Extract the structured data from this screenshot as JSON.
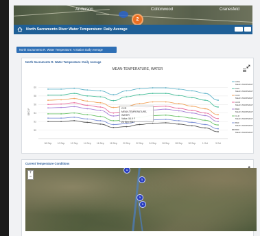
{
  "map_top": {
    "labels": [
      "Anderson",
      "Cottonwood",
      "Cranesfeld"
    ],
    "cluster_count": "2"
  },
  "header": {
    "title": "North Sacramento River Water Temperature: Daily Average",
    "control_a": "",
    "control_b": ""
  },
  "station_button": "North Sacramento R. Water Temperature: A Station Daily Average",
  "chart_panel": {
    "title": "North Sacramento R. Water Temperature: Daily Average",
    "tooltip": {
      "line1": "CCR",
      "line2": "MEAN-TEMPERATURE, WATER",
      "line3": "Value: 54.9 F",
      "line4": "24 Sep 2017"
    }
  },
  "chart_data": {
    "type": "line",
    "title": "MEAN-TEMPERATURE, WATER",
    "ylabel": "DEG F",
    "categories": [
      "06 Sep",
      "10 Sep",
      "12 Sep",
      "14 Sep",
      "16 Sep",
      "18 Sep",
      "20 Sep",
      "22 Sep",
      "24 Sep",
      "26 Sep",
      "28 Sep",
      "30 Sep",
      "1 Oct",
      "3 Oct"
    ],
    "ylim": [
      48,
      62
    ],
    "yticks": [
      50,
      52,
      54,
      56,
      58,
      60
    ],
    "series": [
      {
        "name": "CWA MEAN-TEMPERATURE, WATER",
        "color": "#5fb3c9",
        "values": [
          59.6,
          59.6,
          59.8,
          59.4,
          59.2,
          58.3,
          59.2,
          59.7,
          59.9,
          59.9,
          59.6,
          59.2,
          58.6,
          57.0
        ]
      },
      {
        "name": "KES MEAN-TEMPERATURE, WATER",
        "color": "#4bbf9c",
        "values": [
          58.2,
          58.2,
          58.6,
          58.0,
          57.8,
          56.9,
          57.8,
          58.3,
          58.6,
          58.6,
          58.1,
          57.6,
          57.0,
          55.4
        ]
      },
      {
        "name": "CCR MEAN-TEMPERATURE, WATER",
        "color": "#f0a15a",
        "values": [
          57.0,
          57.1,
          57.4,
          56.8,
          56.4,
          55.3,
          55.6,
          56.2,
          56.6,
          56.6,
          56.2,
          55.6,
          55.0,
          53.6
        ]
      },
      {
        "name": "ACID MEAN-TEMPERATURE, WATER",
        "color": "#e86a9a",
        "values": [
          56.0,
          56.1,
          56.4,
          55.8,
          55.4,
          54.0,
          54.4,
          55.1,
          55.5,
          55.6,
          55.1,
          54.6,
          54.0,
          52.7
        ]
      },
      {
        "name": "BND MEAN-TEMPERATURE, WATER",
        "color": "#a77fd6",
        "values": [
          55.2,
          55.3,
          55.5,
          55.0,
          54.6,
          53.3,
          53.7,
          54.3,
          54.7,
          54.9,
          54.5,
          54.0,
          53.4,
          52.0
        ]
      },
      {
        "name": "CLR MEAN-TEMPERATURE, WATER",
        "color": "#6cc36a",
        "values": [
          53.8,
          53.8,
          54.0,
          53.6,
          53.2,
          52.2,
          52.4,
          53.0,
          53.4,
          53.5,
          53.2,
          52.8,
          52.3,
          51.2
        ]
      },
      {
        "name": "BSF MEAN-TEMPERATURE, WATER",
        "color": "#7b8fd6",
        "values": [
          52.8,
          52.8,
          53.0,
          52.6,
          52.2,
          51.3,
          51.5,
          52.1,
          52.4,
          52.5,
          52.2,
          51.8,
          51.3,
          50.3
        ]
      },
      {
        "name": "BDF MEAN-TEMPERATURE, WATER",
        "color": "#555555",
        "values": [
          52.0,
          52.0,
          52.2,
          51.8,
          51.4,
          50.6,
          50.8,
          51.3,
          51.6,
          51.7,
          51.4,
          51.0,
          50.5,
          49.6
        ]
      }
    ]
  },
  "conditions_panel": {
    "title": "Current Temperature Conditions",
    "pins": [
      "1",
      "1",
      "1",
      "1"
    ]
  },
  "icons": {
    "home": "home-icon",
    "expand": "expand-icon",
    "menu": "menu-icon",
    "zoom_in": "+",
    "zoom_out": "−"
  }
}
